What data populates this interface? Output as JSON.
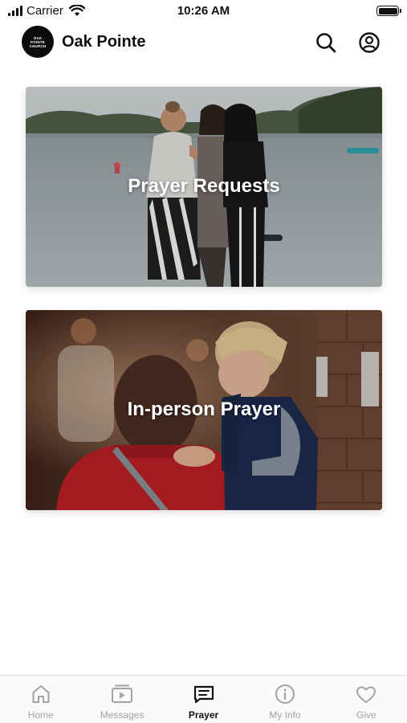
{
  "status_bar": {
    "carrier": "Carrier",
    "time": "10:26 AM"
  },
  "header": {
    "logo_lines": [
      "OAK",
      "POINTE",
      "CHURCH"
    ],
    "title": "Oak Pointe"
  },
  "cards": [
    {
      "label": "Prayer Requests"
    },
    {
      "label": "In-person Prayer"
    }
  ],
  "tabs": [
    {
      "label": "Home",
      "icon": "home-icon",
      "active": false
    },
    {
      "label": "Messages",
      "icon": "video-icon",
      "active": false
    },
    {
      "label": "Prayer",
      "icon": "prayer-icon",
      "active": true
    },
    {
      "label": "My Info",
      "icon": "info-icon",
      "active": false
    },
    {
      "label": "Give",
      "icon": "heart-icon",
      "active": false
    }
  ],
  "colors": {
    "active_tab": "#111111",
    "inactive_tab": "#a3a3a3",
    "background": "#ffffff"
  }
}
